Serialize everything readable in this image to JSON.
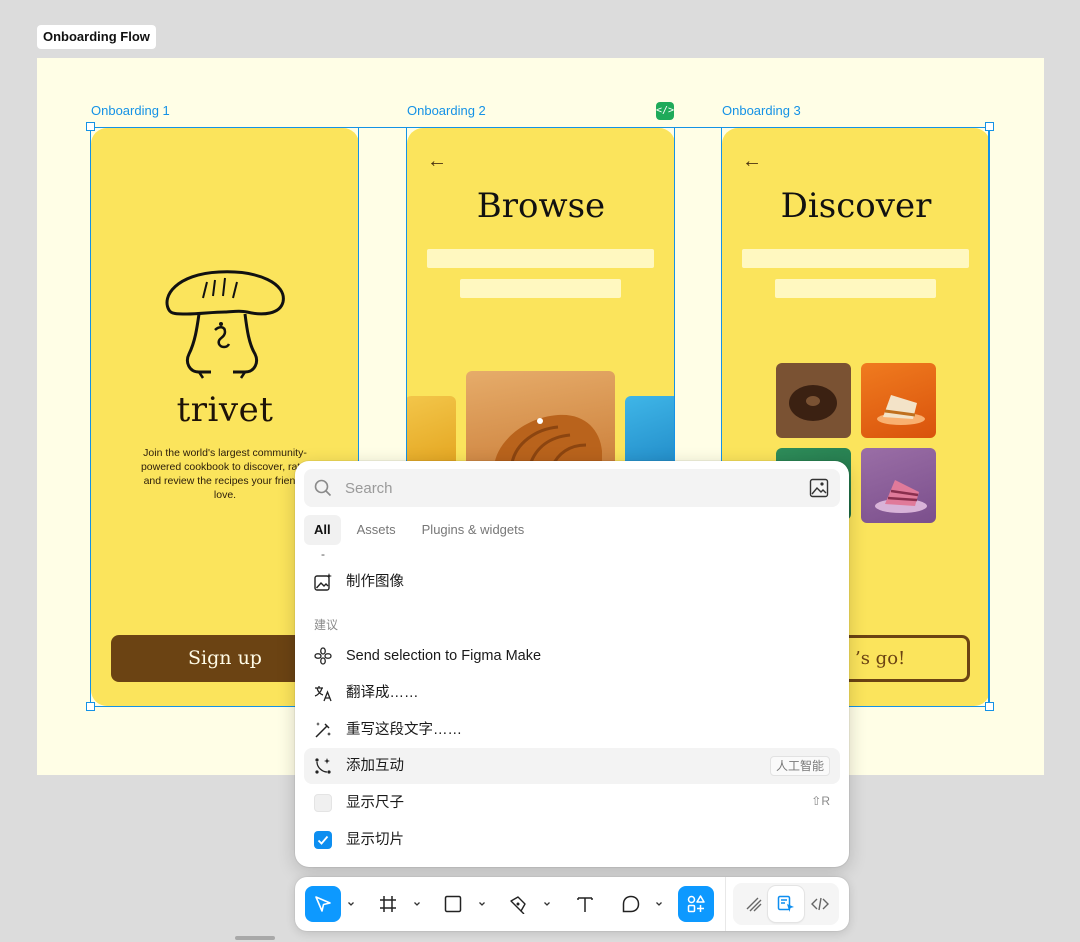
{
  "canvas": {
    "section_title": "Onboarding Flow",
    "frames": [
      {
        "label": "Onboarding 1"
      },
      {
        "label": "Onboarding 2"
      },
      {
        "label": "Onboarding 3"
      }
    ],
    "dev_badge_icon": "code-icon"
  },
  "screen1": {
    "logo_text": "trivet",
    "description": "Join the world's largest community-powered cookbook to discover, rate, and review the recipes your friends love.",
    "signup_label": "Sign up"
  },
  "screen2": {
    "title": "Browse"
  },
  "screen3": {
    "title": "Discover",
    "cta_label": "’s go!"
  },
  "popup": {
    "search_placeholder": "Search",
    "tabs": [
      {
        "label": "All",
        "active": true
      },
      {
        "label": "Assets",
        "active": false
      },
      {
        "label": "Plugins & widgets",
        "active": false
      }
    ],
    "dash": "-",
    "make_image": {
      "label": "制作图像",
      "icon": "image-sparkle-icon"
    },
    "suggestions_label": "建议",
    "items": [
      {
        "label": "Send selection to Figma Make",
        "icon": "figma-make-icon"
      },
      {
        "label": "翻译成……",
        "icon": "translate-icon"
      },
      {
        "label": "重写这段文字……",
        "icon": "magic-wand-icon"
      },
      {
        "label": "添加互动",
        "icon": "interaction-icon",
        "badge": "人工智能"
      },
      {
        "label": "显示尺子",
        "shortcut": "⇧R",
        "checked": false
      },
      {
        "label": "显示切片",
        "checked": true
      }
    ]
  },
  "toolbar": {
    "tools": [
      "move-tool",
      "frame-tool",
      "shape-tool",
      "pen-tool",
      "text-tool",
      "comment-tool",
      "actions-tool"
    ],
    "modes": [
      "draw-mode",
      "design-mode",
      "dev-mode"
    ]
  },
  "colors": {
    "accent": "#0d99ff",
    "selection": "#1592e6",
    "phone_bg": "#fbe45c",
    "button_brown": "#6b4313",
    "section_bg": "#fffee6"
  }
}
